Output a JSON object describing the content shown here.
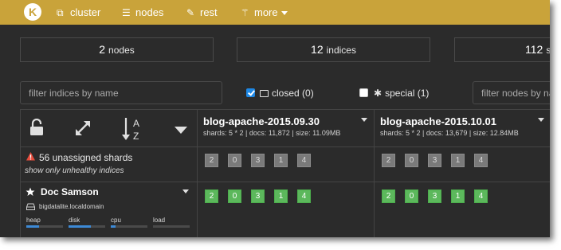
{
  "nav": {
    "logo_letter": "K",
    "items": [
      {
        "label": "cluster",
        "icon": "sitemap-icon",
        "glyph": "⧉"
      },
      {
        "label": "nodes",
        "icon": "list-icon",
        "glyph": "☰"
      },
      {
        "label": "rest",
        "icon": "edit-icon",
        "glyph": "✎"
      },
      {
        "label": "more",
        "icon": "magic-wand-icon",
        "glyph": "⚚"
      }
    ]
  },
  "stats": [
    {
      "value": "2",
      "label": "nodes"
    },
    {
      "value": "12",
      "label": "indices"
    },
    {
      "value": "112",
      "label": "s"
    }
  ],
  "filters": {
    "indices_placeholder": "filter indices by name",
    "closed_label": "closed (0)",
    "closed_checked": true,
    "special_label": "special (1)",
    "special_checked": false,
    "nodes_placeholder": "filter nodes by na"
  },
  "controls": {
    "sort_a": "A",
    "sort_z": "Z"
  },
  "indices": [
    {
      "name": "blog-apache-2015.09.30",
      "meta": "shards: 5 * 2 | docs: 11,872 | size: 11.09MB"
    },
    {
      "name": "blog-apache-2015.10.01",
      "meta": "shards: 5 * 2 | docs: 13,679 | size: 12.84MB"
    }
  ],
  "unassigned": {
    "text": "56 unassigned shards",
    "link": "show only unhealthy indices",
    "shards": [
      "2",
      "0",
      "3",
      "1",
      "4"
    ],
    "color": "#7a7a7a"
  },
  "node": {
    "name": "Doc Samson",
    "host": "bigdatalite.localdomain",
    "shards": [
      "2",
      "0",
      "3",
      "1",
      "4"
    ],
    "color": "#5cb85c",
    "metrics": [
      {
        "label": "heap",
        "fraction": 0.35
      },
      {
        "label": "disk",
        "fraction": 0.6
      },
      {
        "label": "cpu",
        "fraction": 0.12
      },
      {
        "label": "load",
        "fraction": 0.0
      }
    ]
  },
  "colors": {
    "navbar": "#c9a33a",
    "background": "#2b2b2b",
    "accent": "#3d8ad6"
  }
}
